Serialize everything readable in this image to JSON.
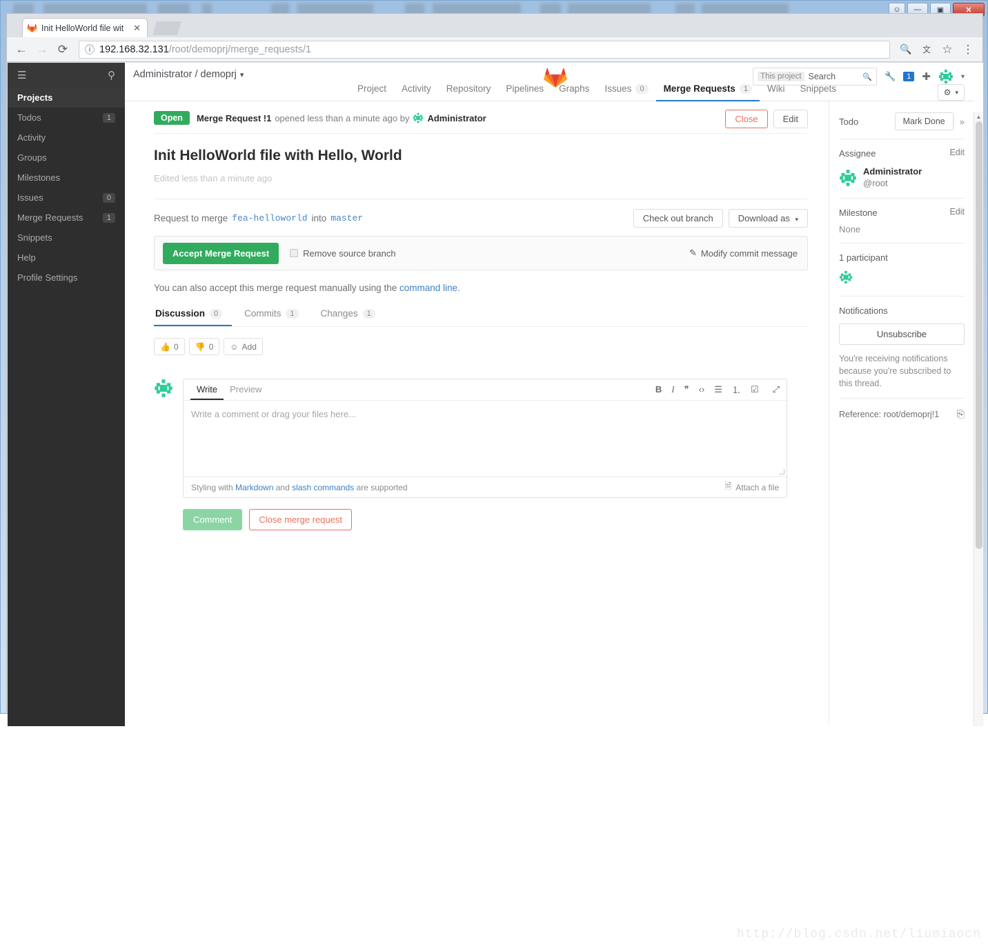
{
  "browser": {
    "tab_title": "Init HelloWorld file wit",
    "tab_close": "✕",
    "url_host": "192.168.32.131",
    "url_path": "/root/demoprj/merge_requests/1",
    "back_icon": "←",
    "forward_icon": "→",
    "reload_icon": "⟳",
    "info_icon": "ⓘ",
    "zoom_icon": "🔍",
    "translate_icon": "文",
    "bookmark_icon": "☆",
    "menu_icon": "⋮"
  },
  "window": {
    "user_icon": "☺",
    "minimize": "—",
    "maximize": "▣",
    "close": "✕"
  },
  "sidebar": {
    "menu_icon": "☰",
    "pin_icon": "⚲",
    "items": [
      {
        "label": "Projects",
        "badge": "",
        "active": true
      },
      {
        "label": "Todos",
        "badge": "1",
        "active": false
      },
      {
        "label": "Activity",
        "badge": "",
        "active": false
      },
      {
        "label": "Groups",
        "badge": "",
        "active": false
      },
      {
        "label": "Milestones",
        "badge": "",
        "active": false
      },
      {
        "label": "Issues",
        "badge": "0",
        "active": false
      },
      {
        "label": "Merge Requests",
        "badge": "1",
        "active": false
      },
      {
        "label": "Snippets",
        "badge": "",
        "active": false
      },
      {
        "label": "Help",
        "badge": "",
        "active": false
      },
      {
        "label": "Profile Settings",
        "badge": "",
        "active": false
      }
    ]
  },
  "header": {
    "breadcrumb": "Administrator / demoprj",
    "breadcrumb_caret": "▾",
    "search_scope": "This project",
    "search_placeholder": "Search",
    "search_icon": "🔍",
    "wrench_icon": "🔧",
    "notification_count": "1",
    "plus_icon": "✚",
    "user_caret": "▾",
    "gear_icon": "⚙",
    "gear_caret": "▾",
    "tabs": [
      {
        "label": "Project",
        "count": "",
        "active": false
      },
      {
        "label": "Activity",
        "count": "",
        "active": false
      },
      {
        "label": "Repository",
        "count": "",
        "active": false
      },
      {
        "label": "Pipelines",
        "count": "",
        "active": false
      },
      {
        "label": "Graphs",
        "count": "",
        "active": false
      },
      {
        "label": "Issues",
        "count": "0",
        "active": false
      },
      {
        "label": "Merge Requests",
        "count": "1",
        "active": true
      },
      {
        "label": "Wiki",
        "count": "",
        "active": false
      },
      {
        "label": "Snippets",
        "count": "",
        "active": false
      }
    ]
  },
  "merge_request": {
    "state": "Open",
    "meta_prefix": "Merge Request !1",
    "meta_text": "opened less than a minute ago by",
    "author": "Administrator",
    "close_button": "Close",
    "edit_button": "Edit",
    "title": "Init HelloWorld file with Hello, World",
    "edited_text": "Edited less than a minute ago",
    "merge_prefix": "Request to merge",
    "source_branch": "fea-helloworld",
    "merge_into": "into",
    "target_branch": "master",
    "checkout_button": "Check out branch",
    "download_button": "Download as",
    "download_caret": "▾",
    "accept_button": "Accept Merge Request",
    "remove_branch_label": "Remove source branch",
    "modify_commit_label": "Modify commit message",
    "modify_commit_icon": "✎",
    "manual_text_before": "You can also accept this merge request manually using the",
    "manual_link": "command line",
    "manual_text_after": "."
  },
  "discussion": {
    "tabs": [
      {
        "label": "Discussion",
        "count": "0",
        "active": true
      },
      {
        "label": "Commits",
        "count": "1",
        "active": false
      },
      {
        "label": "Changes",
        "count": "1",
        "active": false
      }
    ],
    "thumbs_up_icon": "👍",
    "thumbs_up_count": "0",
    "thumbs_down_icon": "👎",
    "thumbs_down_count": "0",
    "add_emoji_icon": "☺",
    "add_emoji_label": "Add"
  },
  "editor": {
    "write_tab": "Write",
    "preview_tab": "Preview",
    "placeholder": "Write a comment or drag your files here...",
    "toolbar": {
      "bold": "B",
      "italic": "I",
      "quote": "❞",
      "code": "‹›",
      "bullet_list": "☰",
      "numbered_list": "⒈",
      "task_list": "☑",
      "fullscreen": "⤢"
    },
    "footer_before": "Styling with",
    "footer_markdown": "Markdown",
    "footer_and": "and",
    "footer_slash": "slash commands",
    "footer_after": "are supported",
    "attach_icon": "🗎",
    "attach_label": "Attach a file",
    "comment_button": "Comment",
    "close_mr_button": "Close merge request"
  },
  "right_sidebar": {
    "todo_label": "Todo",
    "mark_done": "Mark Done",
    "collapse_icon": "»",
    "assignee_label": "Assignee",
    "assignee_edit": "Edit",
    "assignee_name": "Administrator",
    "assignee_handle": "@root",
    "milestone_label": "Milestone",
    "milestone_edit": "Edit",
    "milestone_value": "None",
    "participants_label": "1 participant",
    "notifications_label": "Notifications",
    "unsubscribe_button": "Unsubscribe",
    "notifications_help": "You're receiving notifications because you're subscribed to this thread.",
    "reference_text": "Reference: root/demoprj!1",
    "copy_icon": "⎘"
  },
  "scrollbar": {
    "up_arrow": "▲",
    "down_arrow": "▼"
  },
  "watermark": "http://blog.csdn.net/liumiaocn",
  "colors": {
    "gitlab_orange": "#e24329",
    "open_green": "#31ab5e",
    "accent_blue": "#1f78d1",
    "danger_red": "#e8705a"
  }
}
